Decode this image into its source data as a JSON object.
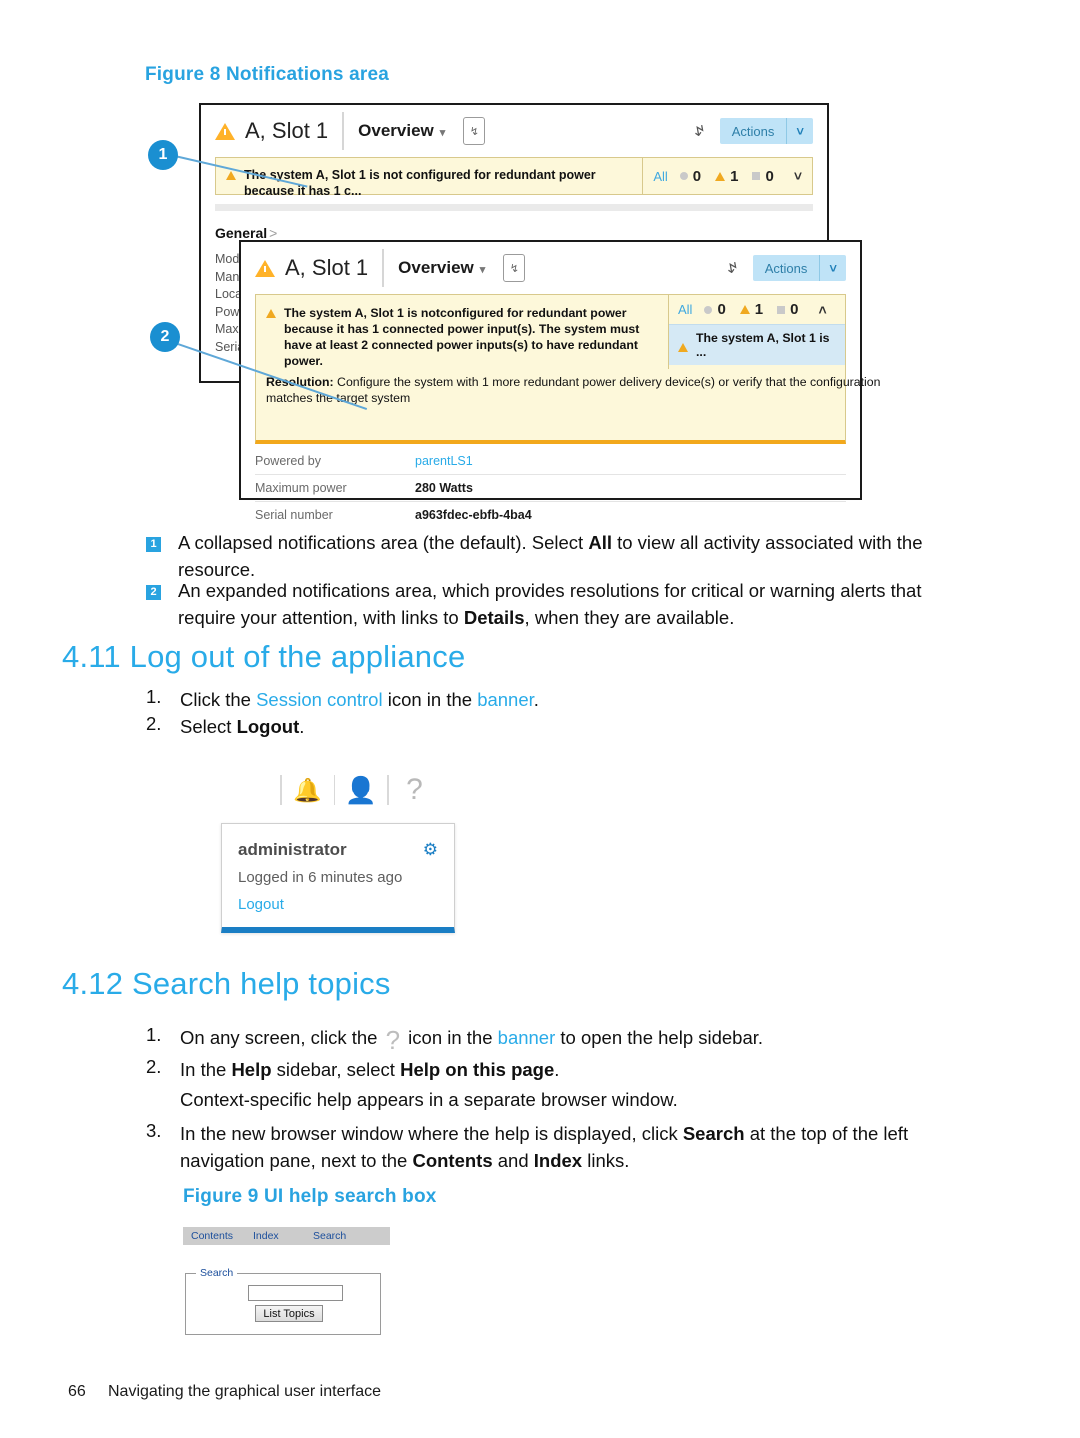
{
  "figure8": {
    "caption": "Figure 8 Notifications area",
    "panel1": {
      "resource_title": "A, Slot 1",
      "view_label": "Overview",
      "actions_label": "Actions",
      "notification_text": "The system A, Slot 1 is not configured for redundant power because it has 1 c...",
      "counts": {
        "all_label": "All",
        "ok": "0",
        "warning": "1",
        "unknown": "0"
      },
      "section_label": "General",
      "properties": [
        "Model",
        "Manag",
        "Locati",
        "Power",
        "Maxim",
        "Serial"
      ]
    },
    "panel2": {
      "resource_title": "A, Slot 1",
      "view_label": "Overview",
      "actions_label": "Actions",
      "notification_text": "The system A, Slot 1 is notconfigured for redundant power because it has 1 connected power input(s). The system must have at least 2 connected power inputs(s) to have redundant power.",
      "resolution_label": "Resolution:",
      "resolution_text": " Configure the system with 1 more redundant power delivery device(s) or verify that the configuration matches the target system",
      "counts": {
        "all_label": "All",
        "ok": "0",
        "warning": "1",
        "unknown": "0"
      },
      "list_item": "The system A, Slot 1 is ...",
      "details": [
        {
          "key": "Powered by",
          "value": "parentLS1",
          "is_link": true
        },
        {
          "key": "Maximum power",
          "value": "280 Watts",
          "is_link": false
        },
        {
          "key": "Serial number",
          "value": "a963fdec-ebfb-4ba4",
          "is_link": false
        }
      ]
    },
    "callouts": {
      "one": "1",
      "two": "2"
    }
  },
  "legend": {
    "item1_num": "1",
    "item1_a": "A collapsed notifications area (the default). Select ",
    "item1_b": "All",
    "item1_c": " to view all activity associated with the resource.",
    "item2_num": "2",
    "item2_a": "An expanded notifications area, which provides resolutions for critical or warning alerts that require your attention, with links to ",
    "item2_b": "Details",
    "item2_c": ", when they are available."
  },
  "section411": {
    "heading": "4.11 Log out of the appliance",
    "step1_num": "1.",
    "step1_a": "Click the ",
    "step1_link": "Session control",
    "step1_b": " icon in the ",
    "step1_link2": "banner",
    "step1_c": ".",
    "step2_num": "2.",
    "step2_a": "Select ",
    "step2_b": "Logout",
    "step2_c": "."
  },
  "session_menu": {
    "bell_icon": "bell-icon",
    "user_icon": "user-icon",
    "help_icon": "question-mark-icon",
    "username": "administrator",
    "gear_icon": "gear-icon",
    "logged_in": "Logged in 6 minutes ago",
    "logout": "Logout"
  },
  "section412": {
    "heading": "4.12 Search help topics",
    "step1_num": "1.",
    "step1_a": "On any screen, click the ",
    "step1_b": " icon in the ",
    "step1_link": "banner",
    "step1_c": " to open the help sidebar.",
    "step2_num": "2.",
    "step2_a": "In the ",
    "step2_b": "Help",
    "step2_c": " sidebar, select ",
    "step2_d": "Help on this page",
    "step2_e": ".",
    "step2_note": "Context-specific help appears in a separate browser window.",
    "step3_num": "3.",
    "step3_a": "In the new browser window where the help is displayed, click ",
    "step3_b": "Search",
    "step3_c": " at the top of the left navigation pane, next to the ",
    "step3_d": "Contents",
    "step3_e": " and ",
    "step3_f": "Index",
    "step3_g": " links."
  },
  "figure9": {
    "caption": "Figure 9 UI help search box",
    "tabs": [
      "Contents",
      "Index",
      "Search"
    ],
    "fieldset_label": "Search",
    "input_value": "",
    "button_label": "List Topics"
  },
  "footer": {
    "page_number": "66",
    "chapter": "Navigating the graphical user interface"
  },
  "colors": {
    "accent_blue": "#29abe8",
    "callout_blue": "#1a8fd1",
    "warning_yellow": "#f0a920",
    "notif_bg": "#fdf8da"
  }
}
